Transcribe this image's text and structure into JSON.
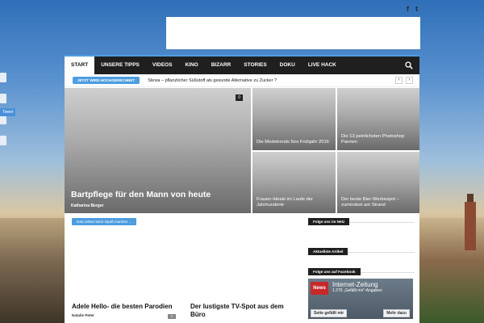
{
  "social": {
    "facebook": "f",
    "twitter": "t"
  },
  "nav": {
    "items": [
      "START",
      "UNSERE TIPPS",
      "VIDEOS",
      "KINO",
      "BIZARR",
      "STORIES",
      "DOKU",
      "LIVE HACK"
    ]
  },
  "ticker": {
    "label": "JETZT WIRD HOCHGERECHNET",
    "text": "Stevia – pflanzlicher Süßstoff als gesunde Alternative zu Zucker ?",
    "prev": "‹",
    "next": "›"
  },
  "side": {
    "tweet": "Tweet"
  },
  "featured": {
    "main": {
      "title": "Bartpflege für den Mann von heute",
      "author": "Katharina Berger",
      "count": "0"
    },
    "tiles": [
      {
        "title": "Die Modetrends fürs Frühjahr 2016"
      },
      {
        "title": "Die 13 peinlichsten Photoshop Pannen"
      },
      {
        "title": "Frauen-Ideale im Laufe der Jahrhunderte"
      },
      {
        "title": "Der beste Bier-Werbespot – zumindest am Strand"
      }
    ]
  },
  "section": {
    "label": "Das Leben kann Spaß machen ..."
  },
  "posts": [
    {
      "title": "Adele Hello- die besten Parodien",
      "author": "Natalie Peter",
      "count": "0"
    },
    {
      "title": "Der lustigste TV-Spot aus dem Büro"
    }
  ],
  "sidebar": {
    "widgets": [
      "Folge uns im Netz",
      "Aktuellste Artikel",
      "Folge uns auf Facebook"
    ],
    "facebook": {
      "logo": "News",
      "name": "Internet-Zeitung",
      "likes": "1.276 „Gefällt mir“-Angaben",
      "like_button": "Seite gefällt mir",
      "more_button": "Mehr dazu"
    }
  },
  "colors": {
    "accent": "#4d9de0",
    "nav_bg": "#1f1f1f"
  }
}
